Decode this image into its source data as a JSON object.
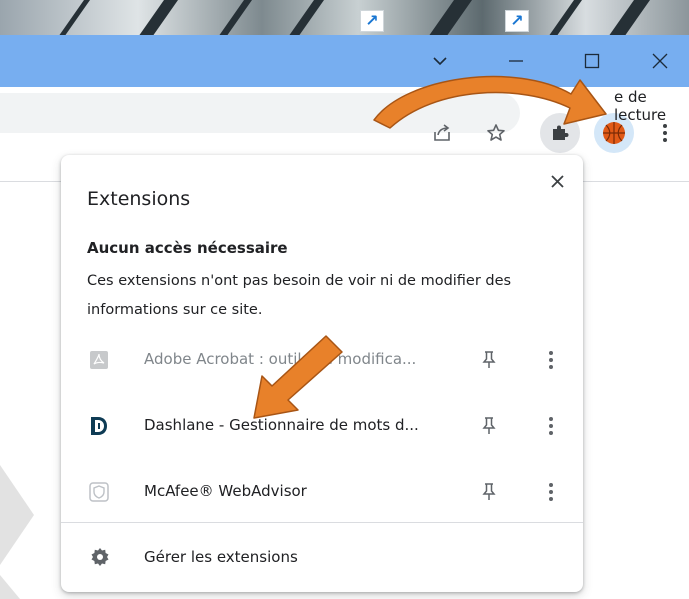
{
  "browser": {
    "icons": {
      "tab_search": "chevron-down-icon",
      "minimize": "minimize-icon",
      "maximize": "maximize-icon",
      "close": "close-icon",
      "share": "share-icon",
      "bookmark": "star-icon",
      "extensions": "puzzle-icon",
      "profile": "basketball-avatar-icon",
      "menu": "kebab-icon"
    },
    "bookmark_bar_text": "e de lecture"
  },
  "popup": {
    "title": "Extensions",
    "section_title": "Aucun accès nécessaire",
    "section_desc": "Ces extensions n'ont pas besoin de voir ni de modifier des informations sur ce site.",
    "extensions": [
      {
        "name": "Adobe Acrobat : outils de modifica...",
        "icon": "adobe-acrobat-icon",
        "disabled": true
      },
      {
        "name": "Dashlane - Gestionnaire de mots d...",
        "icon": "dashlane-icon",
        "disabled": false
      },
      {
        "name": "McAfee® WebAdvisor",
        "icon": "mcafee-shield-icon",
        "disabled": false
      }
    ],
    "manage_label": "Gérer les extensions"
  },
  "colors": {
    "titlebar": "#77aef0",
    "annotation_arrow": "#e8812a",
    "dashlane": "#0e3b54"
  }
}
